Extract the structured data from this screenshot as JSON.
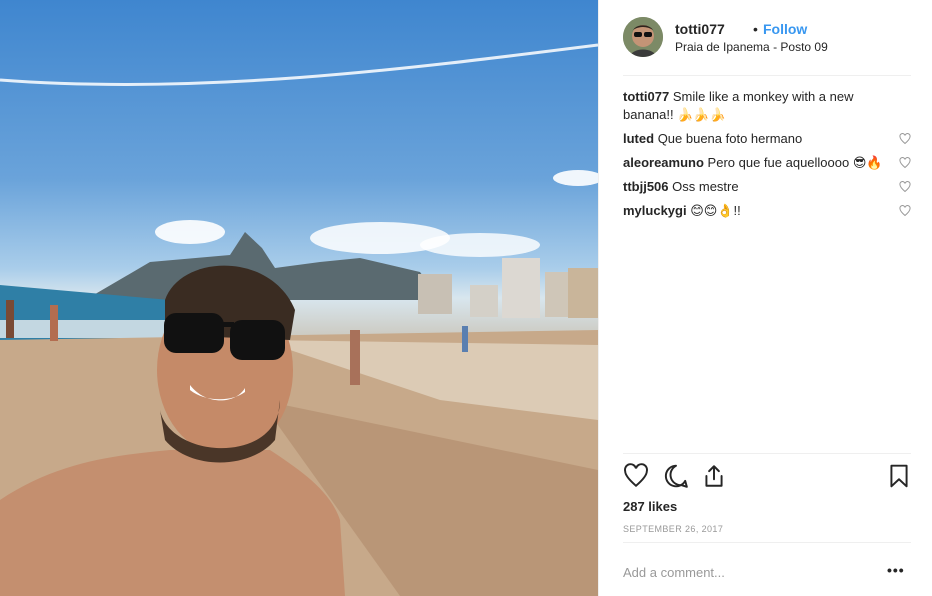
{
  "post": {
    "username": "totti077",
    "separator": "•",
    "follow_label": "Follow",
    "location": "Praia de Ipanema - Posto 09"
  },
  "comments": [
    {
      "user": "totti077",
      "text": "Smile like a monkey with a new banana!! 🍌🍌🍌",
      "has_like": false
    },
    {
      "user": "luted",
      "text": "Que buena foto hermano",
      "has_like": true
    },
    {
      "user": "aleoreamuno",
      "text": "Pero que fue aquelloooo 😎🔥",
      "has_like": true
    },
    {
      "user": "ttbjj506",
      "text": "Oss mestre",
      "has_like": true
    },
    {
      "user": "myluckygi",
      "text": "😊😊👌!!",
      "has_like": true
    }
  ],
  "actions": {
    "icons": [
      "heart-icon",
      "comment-icon",
      "share-icon",
      "bookmark-icon"
    ]
  },
  "likes_text": "287 likes",
  "date_text": "SEPTEMBER 26, 2017",
  "add_comment_placeholder": "Add a comment...",
  "more_label": "•••"
}
